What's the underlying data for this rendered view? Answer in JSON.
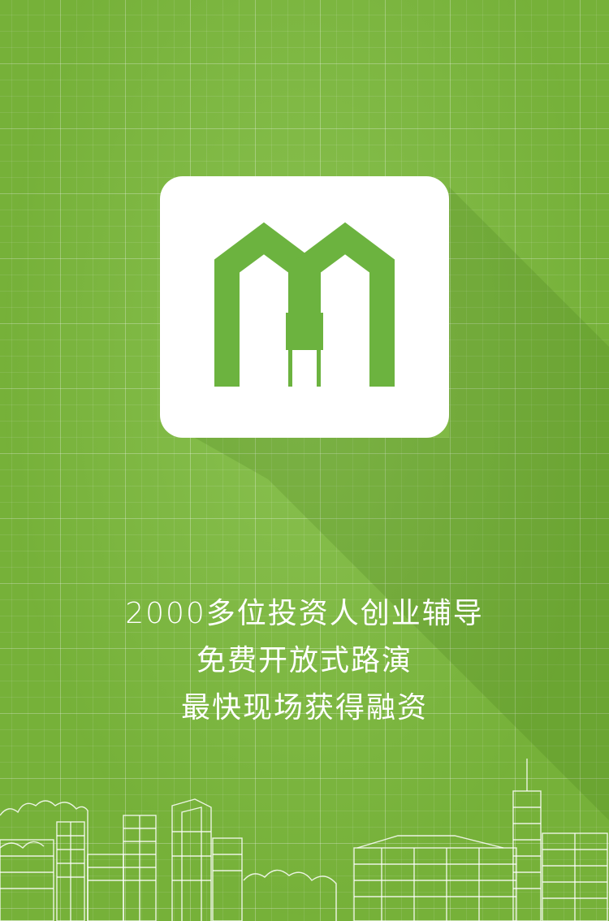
{
  "brand": {
    "logo_icon": "mh-house-logo-icon",
    "logo_color": "#6cb33f",
    "background_color": "#7cba3c"
  },
  "slogan": {
    "line1": "2000多位投资人创业辅导",
    "line2": "免费开放式路演",
    "line3": "最快现场获得融资"
  },
  "decoration": {
    "skyline_icon": "city-skyline-outline"
  }
}
